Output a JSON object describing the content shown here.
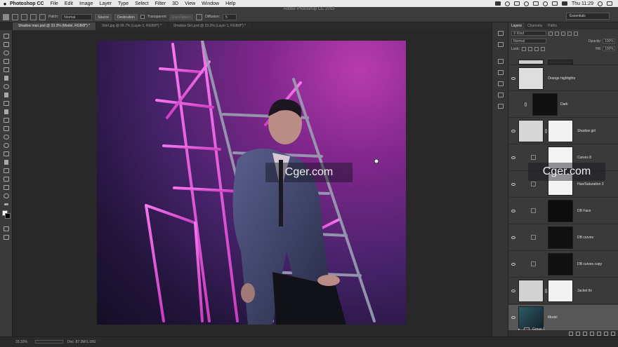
{
  "menubar": {
    "app_name": "Photoshop CC",
    "items": [
      "File",
      "Edit",
      "Image",
      "Layer",
      "Type",
      "Select",
      "Filter",
      "3D",
      "View",
      "Window",
      "Help"
    ],
    "clock": "Thu 11:29"
  },
  "window": {
    "title": "Adobe Photoshop CC 2015"
  },
  "options": {
    "patch_label": "Patch:",
    "patch_value": "Normal",
    "source_label": "Source",
    "destination_label": "Destination",
    "transparent_label": "Transparent",
    "use_pattern_label": "Use Pattern",
    "diffusion_label": "Diffusion:",
    "diffusion_value": "5",
    "workspace": "Essentials"
  },
  "tabs": [
    {
      "label": "Shadow man.psd @ 33.3% (Model, RGB/8*) *",
      "active": true
    },
    {
      "label": "Shirt.jpg @ 66.7% (Layer 0, RGB/8*) *",
      "active": false
    },
    {
      "label": "Shadow Girl.psd @ 33.3% (Layer 1, RGB/8*) *",
      "active": false
    }
  ],
  "watermarks": [
    "Cger.com",
    "Cger.com"
  ],
  "layers_panel": {
    "tabs": [
      "Layers",
      "Channels",
      "Paths"
    ],
    "kind_label": "Kind",
    "blend_mode": "Normal",
    "opacity_label": "Opacity:",
    "opacity_value": "100%",
    "lock_label": "Lock:",
    "fill_label": "Fill:",
    "fill_value": "100%",
    "layers": [
      {
        "name": "Orange highlights",
        "thumb": "light"
      },
      {
        "name": "Dark",
        "thumb": "dark"
      },
      {
        "name": "Shadow girl",
        "thumb": "light"
      },
      {
        "name": "Curves 8",
        "thumb": "white"
      },
      {
        "name": "Hue/Saturation 3",
        "thumb": "white"
      },
      {
        "name": "DB Face",
        "thumb": "dark"
      },
      {
        "name": "DB curves",
        "thumb": "dark"
      },
      {
        "name": "DB curves copy",
        "thumb": "dark"
      },
      {
        "name": "Jacket fix",
        "thumb": "light"
      },
      {
        "name": "Model",
        "thumb": "photo",
        "selected": true
      }
    ],
    "group_name": "Group 1"
  },
  "statusbar": {
    "zoom": "33.33%",
    "doc": "Doc: 87.3M/1.18G"
  },
  "colors": {
    "accent": "#c23fb8",
    "panel_bg": "#3a3a3a",
    "canvas_bg": "#282828"
  }
}
